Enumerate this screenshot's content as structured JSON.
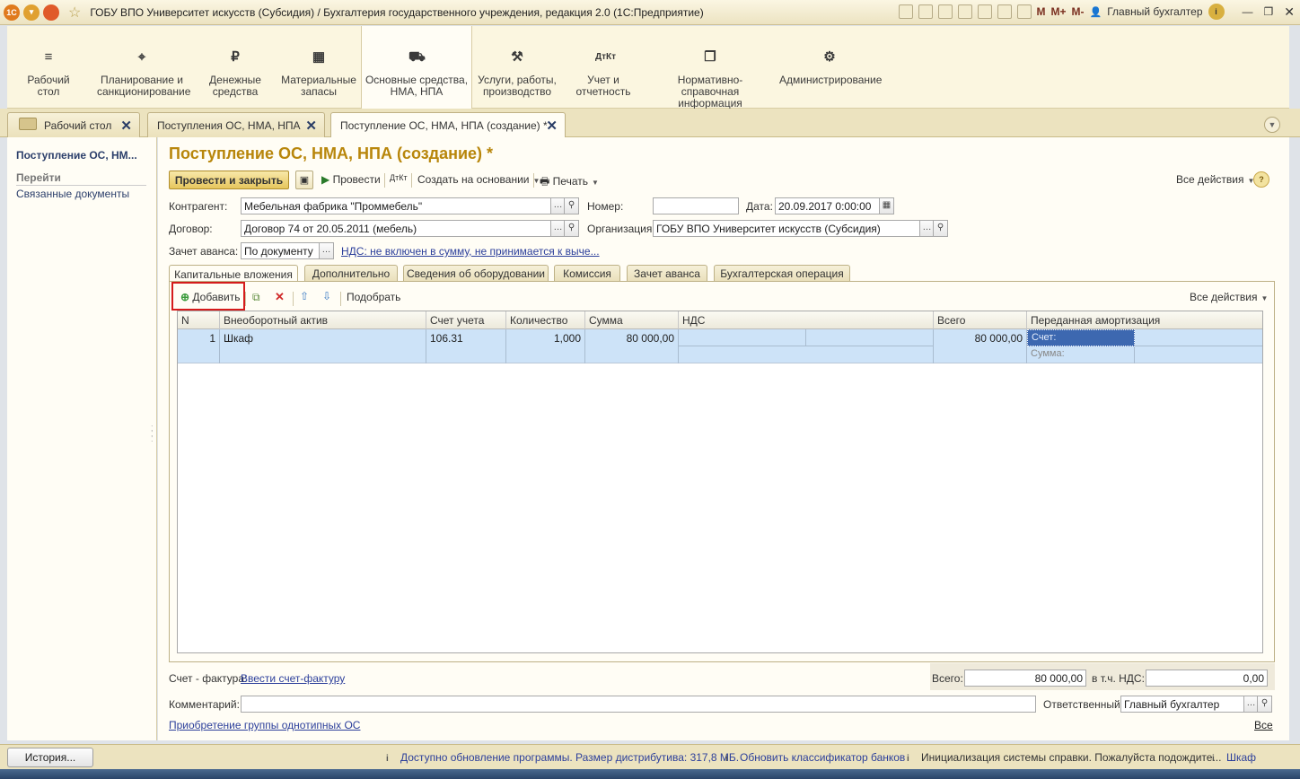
{
  "window": {
    "title": "ГОБУ ВПО Университет искусств (Субсидия) / Бухгалтерия государственного учреждения, редакция 2.0  (1С:Предприятие)",
    "m_labels": [
      "M",
      "M+",
      "M-"
    ],
    "user": "Главный бухгалтер"
  },
  "sections": [
    {
      "label_line1": "Рабочий",
      "label_line2": "стол",
      "icon": "menu-icon"
    },
    {
      "label_line1": "Планирование и",
      "label_line2": "санкционирование",
      "icon": "chart-icon"
    },
    {
      "label_line1": "Денежные",
      "label_line2": "средства",
      "icon": "coin-icon"
    },
    {
      "label_line1": "Материальные",
      "label_line2": "запасы",
      "icon": "grid-icon"
    },
    {
      "label_line1": "Основные средства,",
      "label_line2": "НМА, НПА",
      "icon": "truck-icon"
    },
    {
      "label_line1": "Услуги, работы,",
      "label_line2": "производство",
      "icon": "tools-icon"
    },
    {
      "label_line1": "Учет и",
      "label_line2": "отчетность",
      "icon": "dtkt-icon"
    },
    {
      "label_line1": "Нормативно-справочная",
      "label_line2": "информация",
      "icon": "books-icon"
    },
    {
      "label_line1": "Администрирование",
      "label_line2": "",
      "icon": "gear-icon"
    }
  ],
  "open_tabs": [
    {
      "label": "Рабочий стол"
    },
    {
      "label": "Поступления ОС, НМА, НПА"
    },
    {
      "label": "Поступление ОС, НМА, НПА (создание) *"
    }
  ],
  "left_panel": {
    "title": "Поступление ОС, НМ...",
    "nav_header": "Перейти",
    "link": "Связанные документы"
  },
  "form": {
    "title": "Поступление ОС, НМА, НПА (создание) *",
    "toolbar": {
      "post_close": "Провести и закрыть",
      "post": "Провести",
      "create_based": "Создать на основании",
      "print": "Печать",
      "all_actions": "Все действия"
    },
    "fields": {
      "counterparty_label": "Контрагент:",
      "counterparty_value": "Мебельная фабрика \"Проммебель\"",
      "number_label": "Номер:",
      "number_value": "",
      "date_label": "Дата:",
      "date_value": "20.09.2017  0:00:00",
      "contract_label": "Договор:",
      "contract_value": "Договор 74 от 20.05.2011 (мебель)",
      "org_label": "Организация:",
      "org_value": "ГОБУ ВПО Университет искусств (Субсидия)",
      "advance_label": "Зачет аванса:",
      "advance_value": "По документу",
      "vat_link": "НДС: не включен в сумму, не принимается к выче..."
    },
    "tabs": [
      "Капитальные вложения",
      "Дополнительно",
      "Сведения об оборудовании",
      "Комиссия",
      "Зачет аванса",
      "Бухгалтерская операция"
    ],
    "table_toolbar": {
      "add": "Добавить",
      "pick": "Подобрать",
      "all_actions": "Все действия"
    },
    "table": {
      "headers": [
        "N",
        "Внеоборотный актив",
        "Счет учета",
        "Количество",
        "Сумма",
        "НДС",
        "Всего",
        "Переданная амортизация"
      ],
      "rows": [
        {
          "n": "1",
          "asset": "Шкаф",
          "account": "106.31",
          "qty": "1,000",
          "sum": "80 000,00",
          "total": "80 000,00",
          "amort_account_label": "Счет:",
          "amort_sum_label": "Сумма:"
        }
      ]
    },
    "footer": {
      "invoice_label": "Счет - фактура:",
      "invoice_link": "Ввести счет-фактуру",
      "total_label": "Всего:",
      "total_value": "80 000,00",
      "vat_label": "в т.ч. НДС:",
      "vat_value": "0,00",
      "comment_label": "Комментарий:",
      "comment_value": "",
      "responsible_label": "Ответственный:",
      "responsible_value": "Главный бухгалтер",
      "group_link": "Приобретение группы однотипных ОС",
      "all_link": "Все"
    }
  },
  "statusbar": {
    "history": "История...",
    "msg1": "Доступно обновление программы. Размер дистрибутива: 317,8 МБ.",
    "msg2": "Обновить классификатор банков",
    "msg3": "Инициализация системы справки. Пожалуйста подождите...",
    "msg4": "Шкаф"
  },
  "colors": {
    "title_accent": "#b8860b",
    "selection": "#cde3f8",
    "highlight_box": "#d51b1b"
  }
}
